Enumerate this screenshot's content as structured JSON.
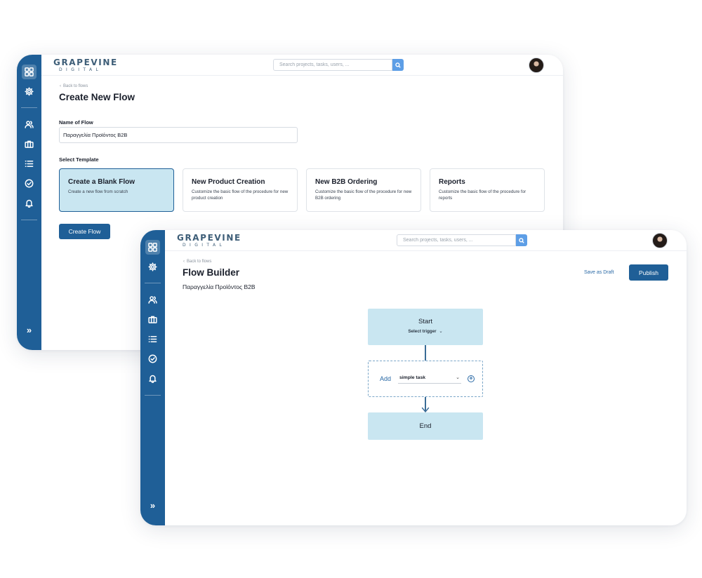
{
  "app": {
    "logo_main": "GRAPEVINE",
    "logo_sub": "DIGITAL",
    "search_placeholder": "Search projects, tasks, users, ...",
    "colors": {
      "sidebar": "#1f5f97",
      "primary": "#1f5f97",
      "selected_card": "#c9e6f1",
      "node": "#c9e6f1",
      "search_button": "#5d9ee6"
    }
  },
  "sidebar": {
    "icons": [
      "grid-icon",
      "gear-icon",
      "users-icon",
      "briefcase-icon",
      "list-icon",
      "check-circle-icon",
      "bell-icon"
    ],
    "expand_label": "»"
  },
  "create_flow": {
    "back_label": "Back to flows",
    "title": "Create New Flow",
    "name_label": "Name of Flow",
    "name_value": "Παραγγελία Προϊόντος B2B",
    "template_label": "Select Template",
    "templates": [
      {
        "title": "Create a Blank Flow",
        "desc": "Create a new flow from scratch",
        "selected": true
      },
      {
        "title": "New Product Creation",
        "desc": "Customize the basic flow of  the procedure for new product creation",
        "selected": false
      },
      {
        "title": "New B2B Ordering",
        "desc": "Customize the basic flow of  the procedure for new B2B ordering",
        "selected": false
      },
      {
        "title": "Reports",
        "desc": "Customize the basic flow of  the procedure for reports",
        "selected": false
      }
    ],
    "create_button": "Create Flow"
  },
  "flow_builder": {
    "back_label": "Back to flows",
    "title": "Flow Builder",
    "flow_name": "Παραγγελία Προϊόντος B2B",
    "save_draft": "Save as Draft",
    "publish": "Publish",
    "start_node": {
      "title": "Start",
      "trigger": "Select trigger"
    },
    "add_step": {
      "label": "Add",
      "task_type": "simple task"
    },
    "end_node": {
      "title": "End"
    }
  }
}
